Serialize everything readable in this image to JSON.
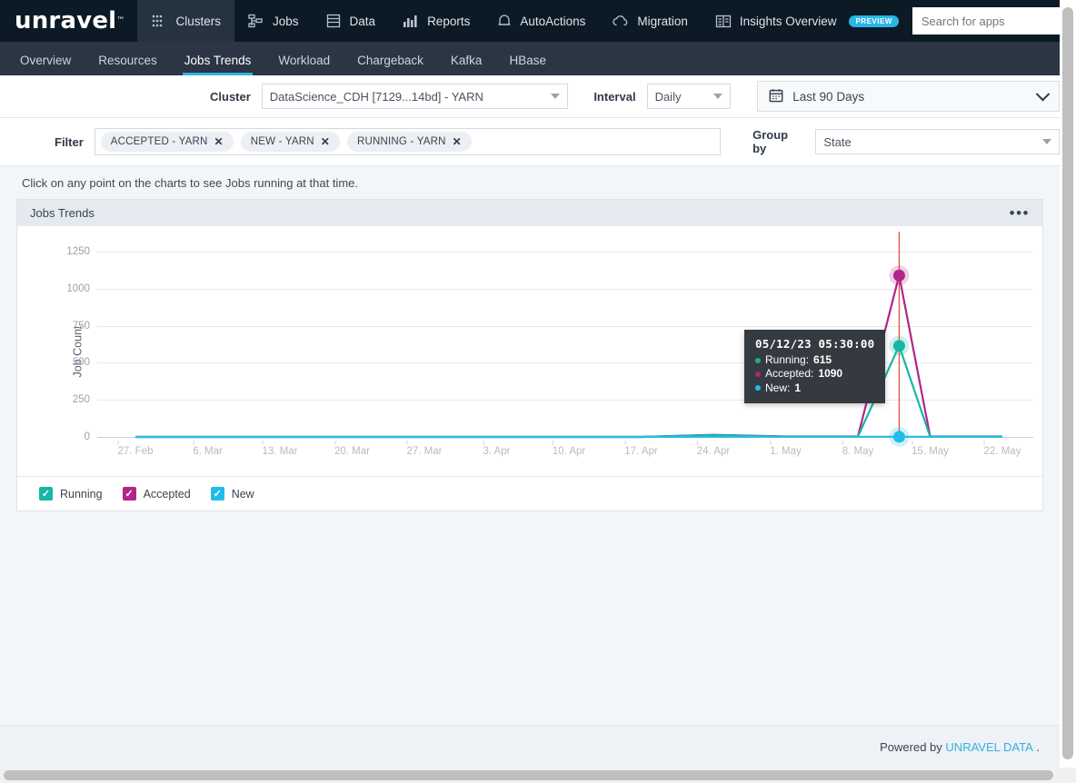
{
  "brand": {
    "name": "unravel",
    "tm": "™"
  },
  "topnav": {
    "items": [
      {
        "label": "Clusters",
        "icon": "clusters-icon",
        "active": true
      },
      {
        "label": "Jobs",
        "icon": "jobs-icon",
        "active": false
      },
      {
        "label": "Data",
        "icon": "data-icon",
        "active": false
      },
      {
        "label": "Reports",
        "icon": "reports-icon",
        "active": false
      },
      {
        "label": "AutoActions",
        "icon": "bell-icon",
        "active": false
      },
      {
        "label": "Migration",
        "icon": "cloud-icon",
        "active": false
      },
      {
        "label": "Insights Overview",
        "icon": "insights-icon",
        "active": false,
        "badge": "PREVIEW"
      }
    ],
    "search_placeholder": "Search for apps",
    "search_value": ""
  },
  "subnav": {
    "tabs": [
      {
        "label": "Overview",
        "active": false
      },
      {
        "label": "Resources",
        "active": false
      },
      {
        "label": "Jobs Trends",
        "active": true
      },
      {
        "label": "Workload",
        "active": false
      },
      {
        "label": "Chargeback",
        "active": false
      },
      {
        "label": "Kafka",
        "active": false
      },
      {
        "label": "HBase",
        "active": false
      }
    ]
  },
  "filters": {
    "cluster_label": "Cluster",
    "cluster_value": "DataScience_CDH [7129...14bd] - YARN",
    "interval_label": "Interval",
    "interval_value": "Daily",
    "daterange_value": "Last 90 Days",
    "daterange_icon": "calendar-icon",
    "filter_label": "Filter",
    "chips": [
      {
        "label": "ACCEPTED - YARN",
        "remove": "✕"
      },
      {
        "label": "NEW - YARN",
        "remove": "✕"
      },
      {
        "label": "RUNNING - YARN",
        "remove": "✕"
      }
    ],
    "groupby_label": "Group by",
    "groupby_value": "State"
  },
  "hint": "Click on any point on the charts to see Jobs running at that time.",
  "panel": {
    "title": "Jobs Trends",
    "menu": "•••"
  },
  "tooltip": {
    "timestamp": "05/12/23 05:30:00",
    "rows": [
      {
        "name": "Running",
        "value": "615",
        "color": "#1aab9b"
      },
      {
        "name": "Accepted",
        "value": "1090",
        "color": "#b0237a"
      },
      {
        "name": "New",
        "value": "1",
        "color": "#22bce8"
      }
    ]
  },
  "legend": {
    "items": [
      {
        "label": "Running",
        "color": "#16b6a4",
        "checked": true,
        "check": "✓"
      },
      {
        "label": "Accepted",
        "color": "#b2258a",
        "checked": true,
        "check": "✓"
      },
      {
        "label": "New",
        "color": "#22bce8",
        "checked": true,
        "check": "✓"
      }
    ]
  },
  "footer": {
    "text": "Powered by",
    "link": "UNRAVEL DATA",
    "suffix": "."
  },
  "chart_data": {
    "type": "line",
    "title": "Jobs Trends",
    "xlabel": "",
    "ylabel": "Job Count",
    "ylim": [
      0,
      1300
    ],
    "yticks": [
      0,
      250,
      500,
      750,
      1000,
      1250
    ],
    "grid": true,
    "legend_position": "bottom",
    "xticks": [
      "27. Feb",
      "6. Mar",
      "13. Mar",
      "20. Mar",
      "27. Mar",
      "3. Apr",
      "10. Apr",
      "17. Apr",
      "24. Apr",
      "1. May",
      "8. May",
      "15. May",
      "22. May"
    ],
    "x_range": [
      "24. Feb",
      "26. May"
    ],
    "highlight_x": "12. May",
    "series": [
      {
        "name": "Running",
        "color": "#16b6a4",
        "x": [
          "27. Feb",
          "6. Mar",
          "13. Mar",
          "20. Mar",
          "27. Mar",
          "3. Apr",
          "10. Apr",
          "17. Apr",
          "24. Apr",
          "1. May",
          "8. May",
          "12. May",
          "15. May",
          "22. May"
        ],
        "values": [
          0,
          0,
          0,
          0,
          0,
          0,
          0,
          0,
          12,
          2,
          2,
          615,
          2,
          2
        ],
        "marker_value": 615
      },
      {
        "name": "Accepted",
        "color": "#b2258a",
        "x": [
          "27. Feb",
          "6. Mar",
          "13. Mar",
          "20. Mar",
          "27. Mar",
          "3. Apr",
          "10. Apr",
          "17. Apr",
          "24. Apr",
          "1. May",
          "8. May",
          "12. May",
          "15. May",
          "22. May"
        ],
        "values": [
          0,
          0,
          0,
          0,
          0,
          0,
          0,
          0,
          14,
          3,
          3,
          1090,
          3,
          3
        ],
        "marker_value": 1090
      },
      {
        "name": "New",
        "color": "#22bce8",
        "x": [
          "27. Feb",
          "6. Mar",
          "13. Mar",
          "20. Mar",
          "27. Mar",
          "3. Apr",
          "10. Apr",
          "17. Apr",
          "24. Apr",
          "1. May",
          "8. May",
          "12. May",
          "15. May",
          "22. May"
        ],
        "values": [
          0,
          0,
          0,
          0,
          0,
          0,
          0,
          0,
          1,
          1,
          1,
          1,
          1,
          1
        ],
        "marker_value": 1
      }
    ]
  }
}
